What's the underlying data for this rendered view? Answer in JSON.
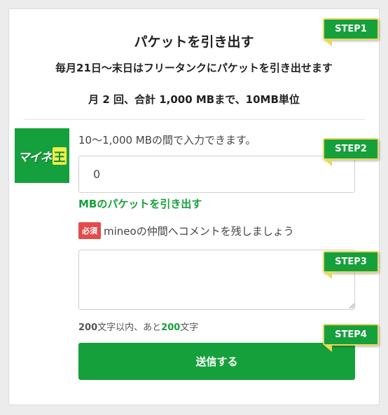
{
  "panel": {
    "title": "パケットを引き出す",
    "rule_line1": "毎月21日〜末日はフリータンクにパケットを引き出せます",
    "rule_line2": "月 2 回、合計 1,000 MBまで、10MB単位"
  },
  "logo": {
    "text": "マイネ",
    "badge": "王"
  },
  "withdraw": {
    "hint": "10〜1,000 MBの間で入力できます。",
    "amount_value": "0",
    "label": "MBのパケットを引き出す"
  },
  "comment": {
    "required_badge": "必須",
    "label": "mineoの仲間へコメントを残しましょう",
    "value": ""
  },
  "counter": {
    "limit": "200",
    "limit_suffix": "文字以内、あと",
    "remaining": "200",
    "remaining_suffix": "文字"
  },
  "submit_label": "送信する",
  "steps": [
    "STEP1",
    "STEP2",
    "STEP3",
    "STEP4"
  ],
  "colors": {
    "accent_green": "#16a03c",
    "step_border": "#e8d95a",
    "required_red": "#e34b4b",
    "logo_badge_yellow": "#f3ee4a"
  }
}
